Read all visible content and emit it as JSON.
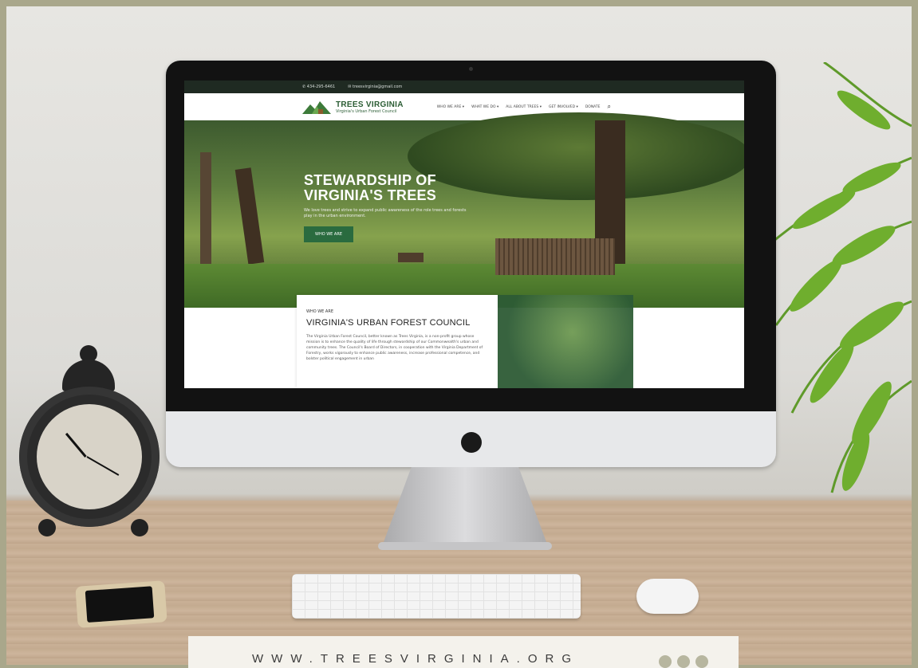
{
  "site": {
    "topbar": {
      "phone": "434-295-6461",
      "email": "treesvirginia@gmail.com"
    },
    "logo": {
      "title": "TREES VIRGINIA",
      "subtitle": "Virginia's Urban Forest Council"
    },
    "nav": [
      {
        "label": "WHO WE ARE ▾"
      },
      {
        "label": "WHAT WE DO ▾"
      },
      {
        "label": "ALL ABOUT TREES ▾"
      },
      {
        "label": "GET INVOLVED ▾"
      },
      {
        "label": "DONATE"
      }
    ],
    "hero": {
      "title_line1": "STEWARDSHIP OF",
      "title_line2": "VIRGINIA'S TREES",
      "subtitle": "We love trees and strive to expand public awareness of the role trees and forests play in the urban environment.",
      "button": "WHO WE ARE"
    },
    "section": {
      "eyebrow": "WHO WE ARE",
      "title": "VIRGINIA'S URBAN FOREST COUNCIL",
      "body": "The Virginia Urban Forest Council, better known as Trees Virginia, is a non-profit group whose mission is to enhance the quality of life through stewardship of our Commonwealth's urban and community trees. The Council's Board of Directors, in cooperation with the Virginia Department of Forestry, works vigorously to enhance public awareness, increase professional competence, and bolster political engagement in urban"
    }
  },
  "banner": {
    "url": "WWW.TREESVIRGINIA.ORG"
  },
  "icons": {
    "phone": "phone-icon",
    "email": "email-icon",
    "search": "search-icon"
  },
  "colors": {
    "brand_green": "#2a6b3f",
    "topbar_bg": "#1f2a22",
    "frame": "#a9a78b"
  }
}
